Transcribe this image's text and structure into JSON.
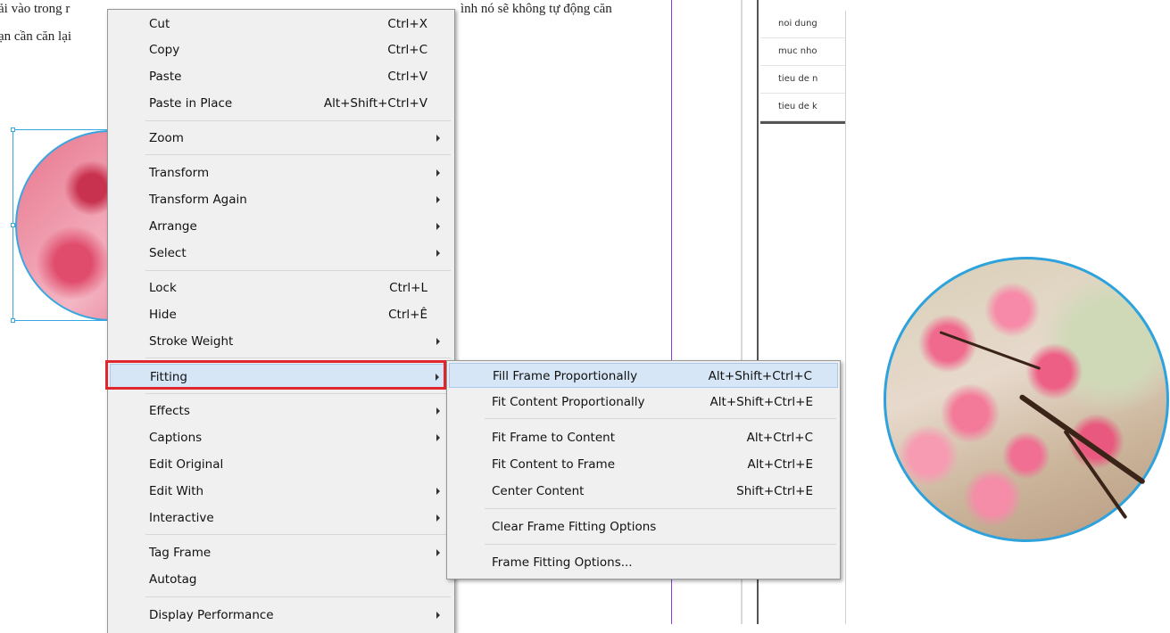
{
  "document": {
    "line1_left": "ải vào trong r",
    "line1_right": "ình nó sẽ không tự động căn",
    "line2_left": "ạn cần căn lại"
  },
  "styles_panel": {
    "items": [
      "noi dung",
      "muc nho",
      "tieu de n",
      "tieu de k"
    ]
  },
  "context_menu": {
    "items": [
      {
        "label": "Cut",
        "shortcut": "Ctrl+X"
      },
      {
        "label": "Copy",
        "shortcut": "Ctrl+C"
      },
      {
        "label": "Paste",
        "shortcut": "Ctrl+V"
      },
      {
        "label": "Paste in Place",
        "shortcut": "Alt+Shift+Ctrl+V"
      },
      {
        "label": "Zoom",
        "submenu": true
      },
      {
        "label": "Transform",
        "submenu": true
      },
      {
        "label": "Transform Again",
        "submenu": true
      },
      {
        "label": "Arrange",
        "submenu": true
      },
      {
        "label": "Select",
        "submenu": true
      },
      {
        "label": "Lock",
        "shortcut": "Ctrl+L"
      },
      {
        "label": "Hide",
        "shortcut": "Ctrl+Ê"
      },
      {
        "label": "Stroke Weight",
        "submenu": true
      },
      {
        "label": "Fitting",
        "submenu": true,
        "highlighted": true
      },
      {
        "label": "Effects",
        "submenu": true
      },
      {
        "label": "Captions",
        "submenu": true
      },
      {
        "label": "Edit Original"
      },
      {
        "label": "Edit With",
        "submenu": true
      },
      {
        "label": "Interactive",
        "submenu": true
      },
      {
        "label": "Tag Frame",
        "submenu": true
      },
      {
        "label": "Autotag"
      },
      {
        "label": "Display Performance",
        "submenu": true
      }
    ]
  },
  "fitting_submenu": {
    "items": [
      {
        "label": "Fill Frame Proportionally",
        "shortcut": "Alt+Shift+Ctrl+C",
        "highlighted": true
      },
      {
        "label": "Fit Content Proportionally",
        "shortcut": "Alt+Shift+Ctrl+E"
      },
      {
        "label": "Fit Frame to Content",
        "shortcut": "Alt+Ctrl+C"
      },
      {
        "label": "Fit Content to Frame",
        "shortcut": "Alt+Ctrl+E"
      },
      {
        "label": "Center Content",
        "shortcut": "Shift+Ctrl+E"
      },
      {
        "label": "Clear Frame Fitting Options"
      },
      {
        "label": "Frame Fitting Options..."
      }
    ]
  },
  "colors": {
    "highlight": "#d6e6f6",
    "callout": "#e0262e",
    "selection": "#3aa6e0",
    "guide": "#8a3fd8"
  }
}
